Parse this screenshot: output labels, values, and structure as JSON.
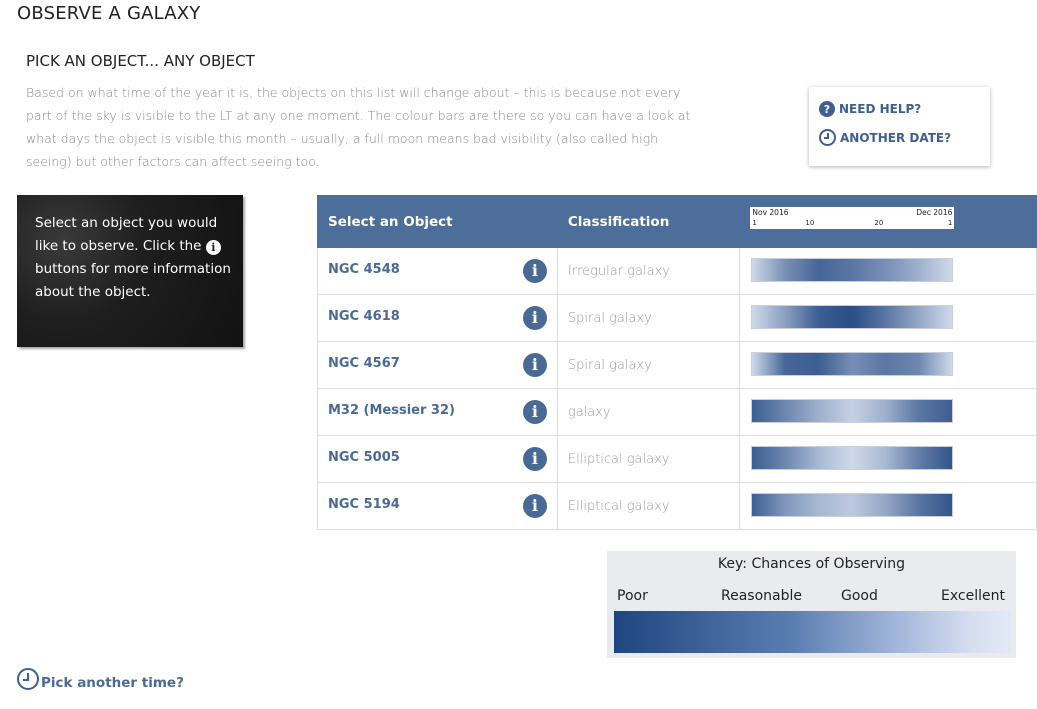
{
  "page": {
    "title": "OBSERVE A GALAXY",
    "section_title": "PICK AN OBJECT... ANY OBJECT",
    "intro": "Based on what time of the year it is, the objects on this list will change about – this is because not every part of the sky is visible to the LT at any one moment. The colour bars are there so you can have a look at what days the object is visible this month – usually, a full moon means bad visibility (also called high seeing) but other factors can affect seeing too."
  },
  "help": {
    "need_help": "NEED HELP?",
    "need_help_icon": "question-icon",
    "another_date": "ANOTHER DATE?",
    "another_date_icon": "clock-icon"
  },
  "instructions": {
    "text_before": "Select an object you would like to observe. Click the",
    "text_after": "buttons for more information about the object.",
    "icon": "info-icon"
  },
  "table": {
    "headers": {
      "object": "Select an Object",
      "classification": "Classification"
    },
    "calendar": {
      "start_label": "Nov 2016",
      "end_label": "Dec 2016",
      "ticks": [
        "1",
        "10",
        "20",
        "1"
      ]
    },
    "rows": [
      {
        "name": "NGC 4548",
        "classification": "Irregular galaxy",
        "visibility": [
          0.1,
          0.55,
          0.8,
          0.7,
          0.55,
          0.35,
          0.1
        ]
      },
      {
        "name": "NGC 4618",
        "classification": "Spiral galaxy",
        "visibility": [
          0.1,
          0.45,
          0.85,
          0.95,
          0.7,
          0.4,
          0.1
        ]
      },
      {
        "name": "NGC 4567",
        "classification": "Spiral galaxy",
        "visibility": [
          0.1,
          0.8,
          0.85,
          0.55,
          0.7,
          0.6,
          0.1
        ]
      },
      {
        "name": "M32 (Messier 32)",
        "classification": "galaxy",
        "visibility": [
          0.85,
          0.6,
          0.35,
          0.15,
          0.35,
          0.7,
          0.85
        ]
      },
      {
        "name": "NGC 5005",
        "classification": "Elliptical galaxy",
        "visibility": [
          0.85,
          0.6,
          0.3,
          0.1,
          0.3,
          0.65,
          0.9
        ]
      },
      {
        "name": "NGC 5194",
        "classification": "Elliptical galaxy",
        "visibility": [
          0.85,
          0.5,
          0.3,
          0.2,
          0.4,
          0.7,
          0.9
        ]
      }
    ]
  },
  "key": {
    "title": "Key: Chances of Observing",
    "poor": "Poor",
    "reasonable": "Reasonable",
    "good": "Good",
    "excellent": "Excellent"
  },
  "footer": {
    "pick_time": "Pick another time?",
    "icon": "clock-icon"
  },
  "colors": {
    "accent": "#4a6a96",
    "header": "#4d6d9a",
    "poor": "#1f4580",
    "excellent": "#e3e9f6"
  }
}
